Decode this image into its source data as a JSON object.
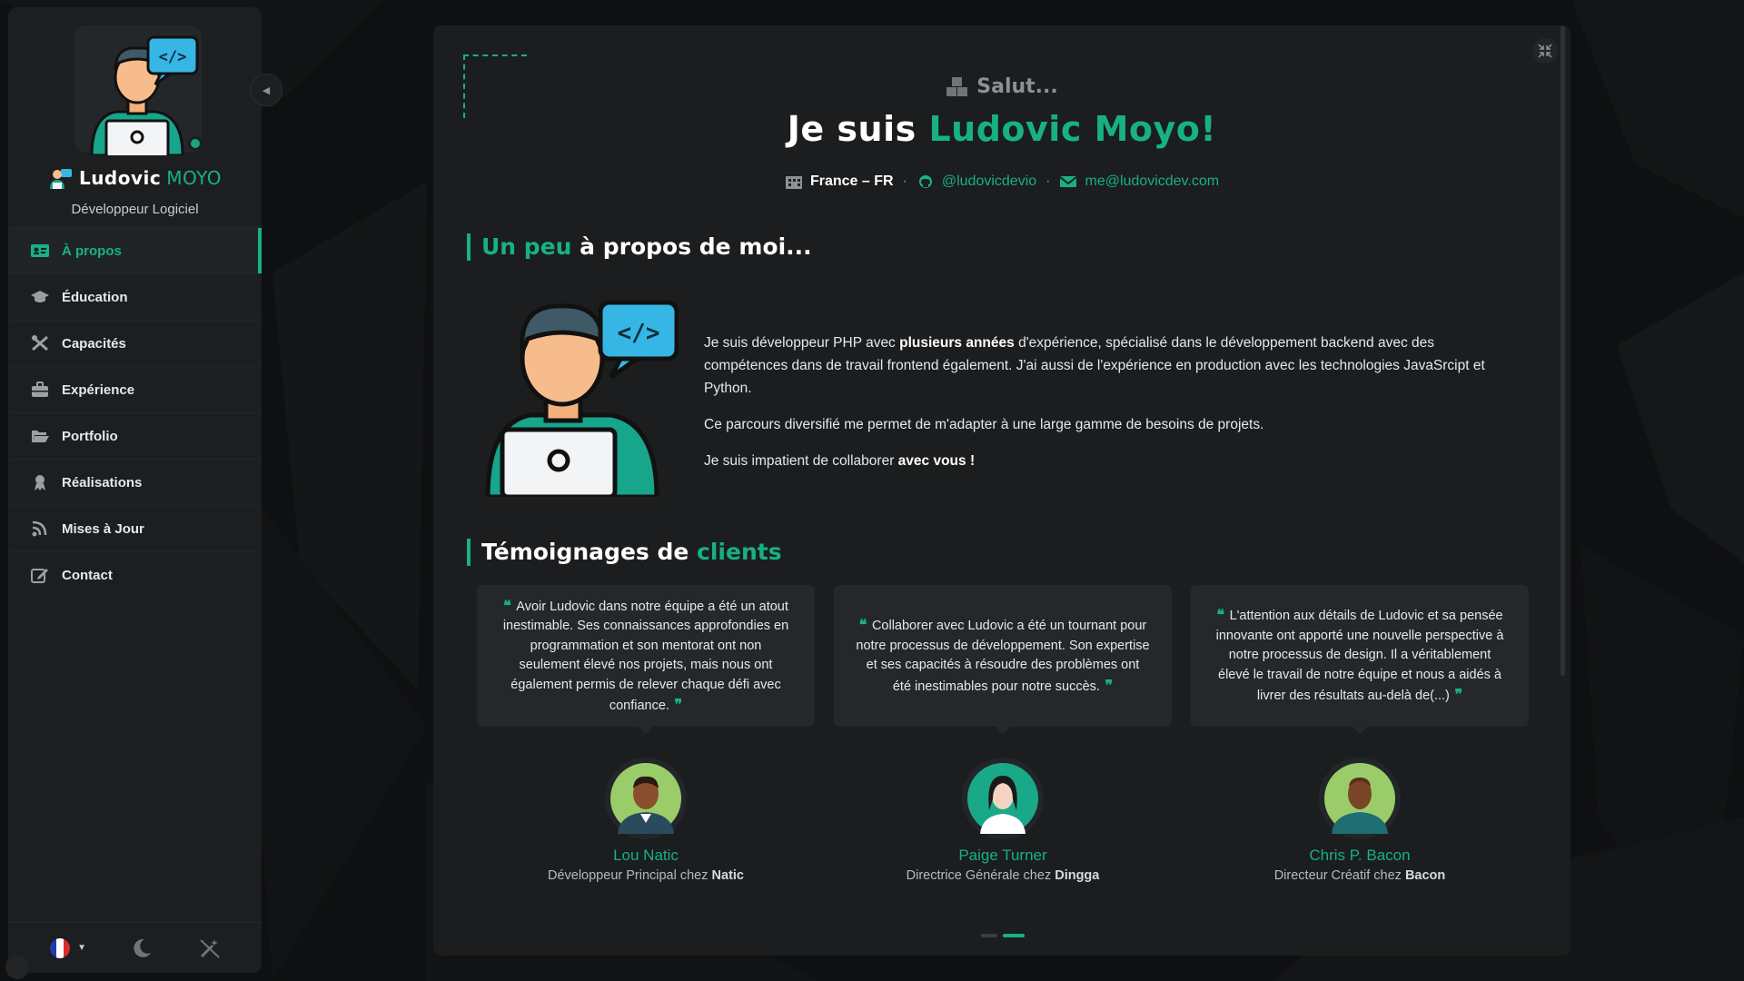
{
  "sidebar": {
    "name_first": "Ludovic",
    "name_last": "MOYO",
    "role": "Développeur Logiciel",
    "nav": [
      {
        "label": "À propos",
        "icon": "id-card-icon",
        "active": true
      },
      {
        "label": "Éducation",
        "icon": "graduation-cap-icon"
      },
      {
        "label": "Capacités",
        "icon": "tools-icon"
      },
      {
        "label": "Expérience",
        "icon": "briefcase-icon"
      },
      {
        "label": "Portfolio",
        "icon": "folder-open-icon"
      },
      {
        "label": "Réalisations",
        "icon": "award-icon"
      },
      {
        "label": "Mises à Jour",
        "icon": "rss-icon"
      },
      {
        "label": "Contact",
        "icon": "edit-icon"
      }
    ],
    "footer": {
      "language_icon": "france-flag-icon",
      "theme_icon": "moon-icon",
      "effects_icon": "magic-wand-off-icon"
    }
  },
  "main": {
    "greeting": "Salut...",
    "headline_prefix": "Je suis ",
    "headline_name": "Ludovic Moyo!",
    "location": "France – FR",
    "github": "@ludovicdevio",
    "email": "me@ludovicdev.com",
    "about_title_accent": "Un peu",
    "about_title_rest": " à propos de moi...",
    "about_p1_a": "Je suis développeur PHP avec ",
    "about_p1_b": "plusieurs années",
    "about_p1_c": " d'expérience, spécialisé dans le développement backend avec des compétences dans de travail frontend également. J'ai aussi de l'expérience en production avec les technologies JavaSrcipt et Python.",
    "about_p2": "Ce parcours diversifié me permet de m'adapter à une large gamme de besoins de projets.",
    "about_p3_a": "Je suis impatient de collaborer ",
    "about_p3_b": "avec vous !",
    "testimonials_title_rest": "Témoignages de ",
    "testimonials_title_accent": "clients",
    "testimonials": [
      {
        "quote": "Avoir Ludovic dans notre équipe a été un atout inestimable. Ses connaissances approfondies en programmation et son mentorat ont non seulement élevé nos projets, mais nous ont également permis de relever chaque défi avec confiance.",
        "name": "Lou Natic",
        "role": "Développeur Principal chez ",
        "company": "Natic"
      },
      {
        "quote": "Collaborer avec Ludovic a été un tournant pour notre processus de développement. Son expertise et ses capacités à résoudre des problèmes ont été inestimables pour notre succès.",
        "name": "Paige Turner",
        "role": "Directrice Générale chez ",
        "company": "Dingga"
      },
      {
        "quote": "L'attention aux détails de Ludovic et sa pensée innovante ont apporté une nouvelle perspective à notre processus de design. Il a véritablement élevé le travail de notre équipe et nous a aidés à livrer des résultats au-delà de(...)",
        "name": "Chris P. Bacon",
        "role": "Directeur Créatif chez ",
        "company": "Bacon"
      }
    ],
    "carousel_pages": 2,
    "carousel_active": 2
  },
  "colors": {
    "accent": "#18b085",
    "panel": "#1b1d1f",
    "sidebar": "#1c1e20",
    "background": "#0f1011"
  }
}
